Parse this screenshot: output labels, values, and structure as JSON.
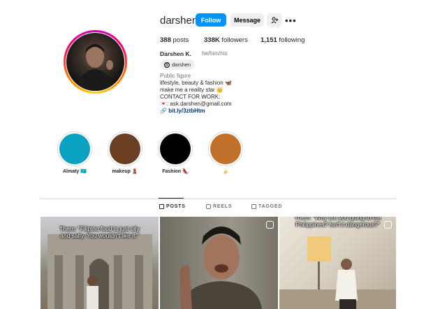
{
  "profile": {
    "username": "darshen",
    "follow_label": "Follow",
    "message_label": "Message",
    "add_user_icon": "add-user-icon",
    "more_label": "•••",
    "posts_count": "388",
    "posts_label": "posts",
    "followers_count": "338K",
    "followers_label": "followers",
    "following_count": "1,151",
    "following_label": "following",
    "full_name": "Darshen K.",
    "pronouns": "he/him/his",
    "threads_handle": "darshen",
    "bio": {
      "category": "Public figure",
      "line1": "lifestyle, beauty & fashion 🦋",
      "line2": "make me a reality star 👑",
      "line3": "CONTACT FOR WORK:",
      "line4": "💌: ask.darshen@gmail.com",
      "link": "bit.ly/3ztbHtm"
    }
  },
  "highlights": [
    {
      "label": "Almaty 🇰🇿",
      "color": "#0aa2c0"
    },
    {
      "label": "makeup 💄",
      "color": "#6b3f22"
    },
    {
      "label": "Fashion 👠",
      "color": "#000000"
    },
    {
      "label": "🍌",
      "color": "#c2712c"
    }
  ],
  "tabs": [
    {
      "label": "POSTS",
      "active": true
    },
    {
      "label": "REELS",
      "active": false
    },
    {
      "label": "TAGGED",
      "active": false
    }
  ],
  "posts": [
    {
      "caption": "Them: \"Filipino food is just oily and salty. You wouldn't like it.\""
    },
    {
      "caption": ""
    },
    {
      "caption": "Them: \"Why are you going to the Philippines? Isn't it dangerous?\""
    }
  ]
}
